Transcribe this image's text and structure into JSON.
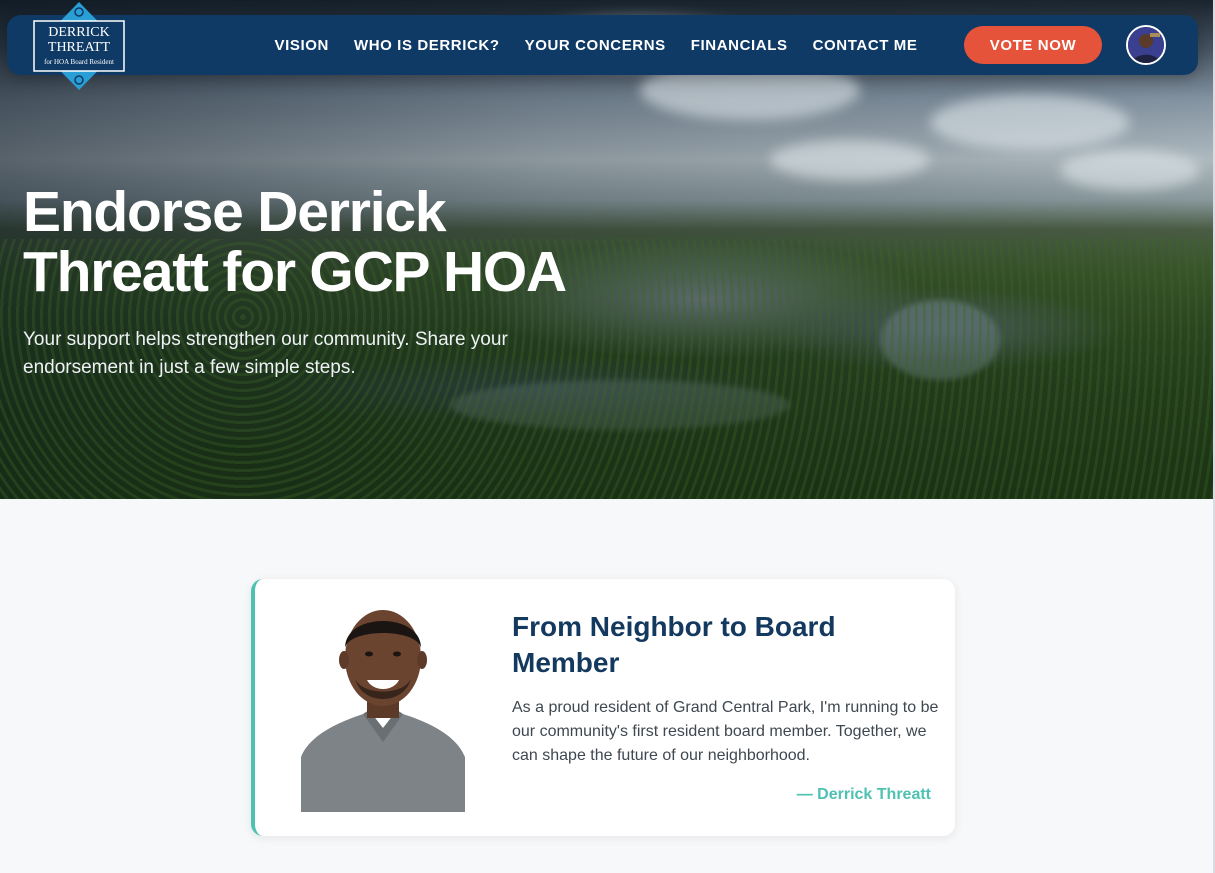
{
  "brand": {
    "logo_line1": "DERRICK",
    "logo_line2": "THREATT",
    "logo_tagline": "for HOA Board Resident",
    "logo_icon": "diamond-badge-icon"
  },
  "nav": {
    "links": [
      {
        "label": "VISION"
      },
      {
        "label": "WHO IS DERRICK?"
      },
      {
        "label": "YOUR CONCERNS"
      },
      {
        "label": "FINANCIALS"
      },
      {
        "label": "CONTACT ME"
      }
    ],
    "cta_label": "VOTE NOW",
    "avatar_icon": "user-avatar-icon"
  },
  "hero": {
    "title": "Endorse Derrick Threatt for GCP HOA",
    "subtitle": "Your support helps strengthen our community. Share your endorsement in just a few simple steps."
  },
  "card": {
    "title": "From Neighbor to Board Member",
    "body": "As a proud resident of Grand Central Park, I'm running to be our community's first resident board member. Together, we can shape the future of our neighborhood.",
    "signature": "— Derrick Threatt"
  },
  "colors": {
    "navy": "#0f3a66",
    "accent_orange": "#e5533a",
    "teal": "#4fc1b2",
    "title_navy": "#14395f",
    "logo_blue": "#2a9fd6"
  }
}
